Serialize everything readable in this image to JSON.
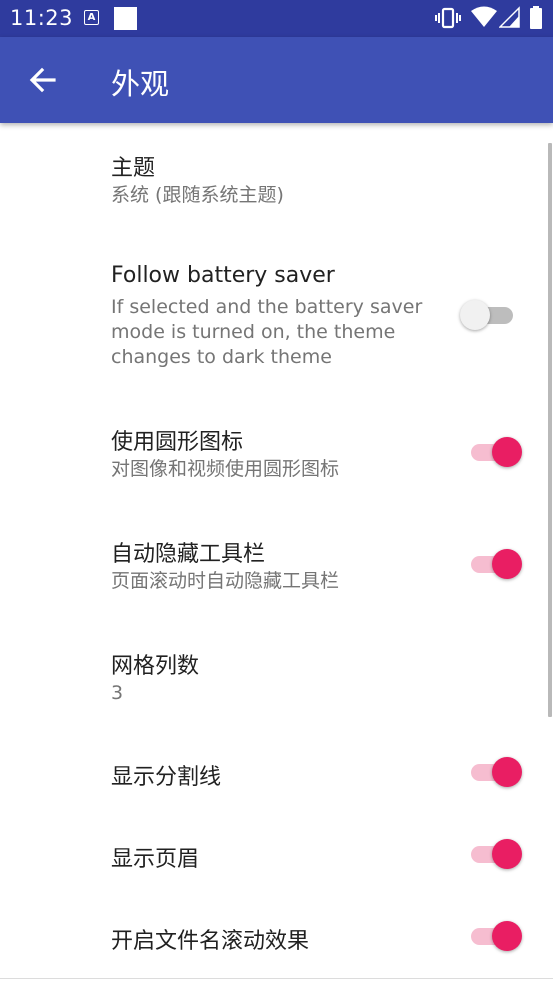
{
  "status_bar": {
    "time": "11:23",
    "a_badge": "A",
    "icons": [
      "a-badge-icon",
      "square-icon",
      "vibrate-icon",
      "wifi-icon",
      "signal-icon",
      "battery-icon"
    ]
  },
  "app_bar": {
    "title": "外观",
    "back_icon": "arrow-back-icon"
  },
  "colors": {
    "app_bar": "#3f51b5",
    "status_bar": "#2f3b9e",
    "accent": "#e91e63",
    "accent_track": "#f6bdd0"
  },
  "prefs": [
    {
      "title": "主题",
      "summary": "系统 (跟随系统主题)"
    },
    {
      "title": "Follow battery saver",
      "summary": "If selected and the battery saver mode is turned on, the theme changes to dark theme",
      "switch_on": false
    },
    {
      "title": "使用圆形图标",
      "summary": "对图像和视频使用圆形图标",
      "switch_on": true
    },
    {
      "title": "自动隐藏工具栏",
      "summary": "页面滚动时自动隐藏工具栏",
      "switch_on": true
    },
    {
      "title": "网格列数",
      "summary": "3"
    },
    {
      "title": "显示分割线",
      "switch_on": true
    },
    {
      "title": "显示页眉",
      "switch_on": true
    },
    {
      "title": "开启文件名滚动效果",
      "switch_on": true
    }
  ]
}
